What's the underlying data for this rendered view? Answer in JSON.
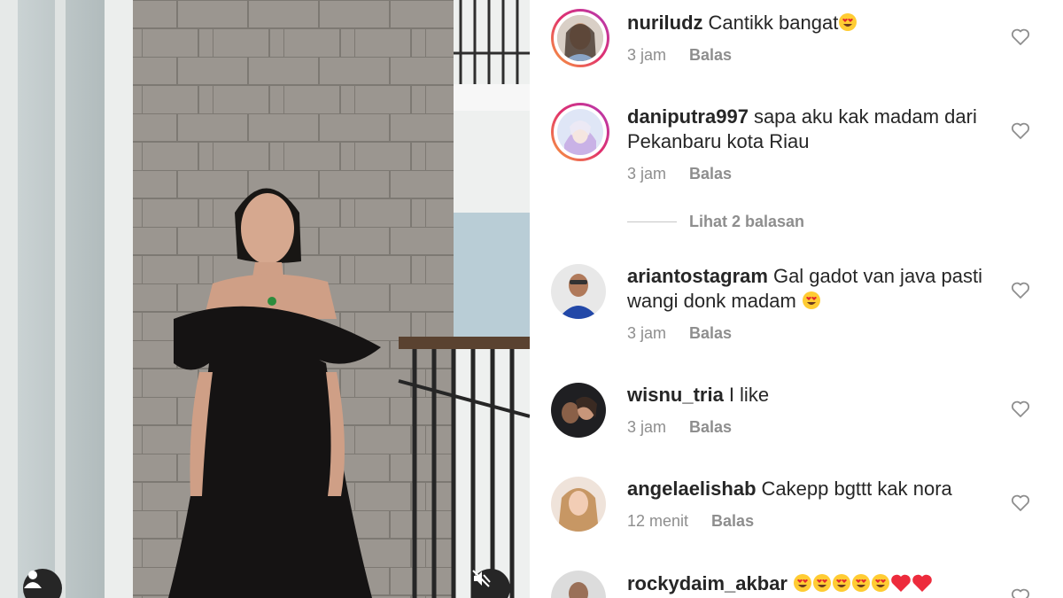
{
  "media": {
    "user_tag_icon": "user-icon",
    "mute_icon": "speaker-muted-icon"
  },
  "comments": [
    {
      "username": "nuriludz",
      "text": "Cantikk bangat",
      "emoji": [
        "heart-eyes-emoji"
      ],
      "time": "3 jam",
      "reply_label": "Balas",
      "avatar_ring": true
    },
    {
      "username": "daniputra997",
      "text": "sapa aku kak madam dari Pekanbaru kota Riau",
      "emoji": [],
      "time": "3 jam",
      "reply_label": "Balas",
      "avatar_ring": true
    },
    {
      "username": "ariantostagram",
      "text": "Gal gadot van java pasti wangi donk madam",
      "emoji": [
        "heart-eyes-emoji"
      ],
      "time": "3 jam",
      "reply_label": "Balas",
      "avatar_ring": false
    },
    {
      "username": "wisnu_tria",
      "text": "I like",
      "emoji": [],
      "time": "3 jam",
      "reply_label": "Balas",
      "avatar_ring": false
    },
    {
      "username": "angelaelishab",
      "text": "Cakepp bgttt kak nora",
      "emoji": [],
      "time": "12 menit",
      "reply_label": "Balas",
      "avatar_ring": false
    },
    {
      "username": "rockydaim_akbar",
      "text": "",
      "emoji": [
        "heart-eyes-emoji",
        "heart-eyes-emoji",
        "heart-eyes-emoji",
        "heart-eyes-emoji",
        "heart-eyes-emoji",
        "red-heart-emoji",
        "red-heart-emoji"
      ],
      "time": "",
      "reply_label": "",
      "avatar_ring": false
    }
  ],
  "view_replies_label": "Lihat 2 balasan",
  "colors": {
    "text": "#262626",
    "secondary": "#8e8e8e",
    "ring_start": "#f9a23c",
    "ring_end": "#b13ab9",
    "heart_red": "#ed2b3c"
  }
}
